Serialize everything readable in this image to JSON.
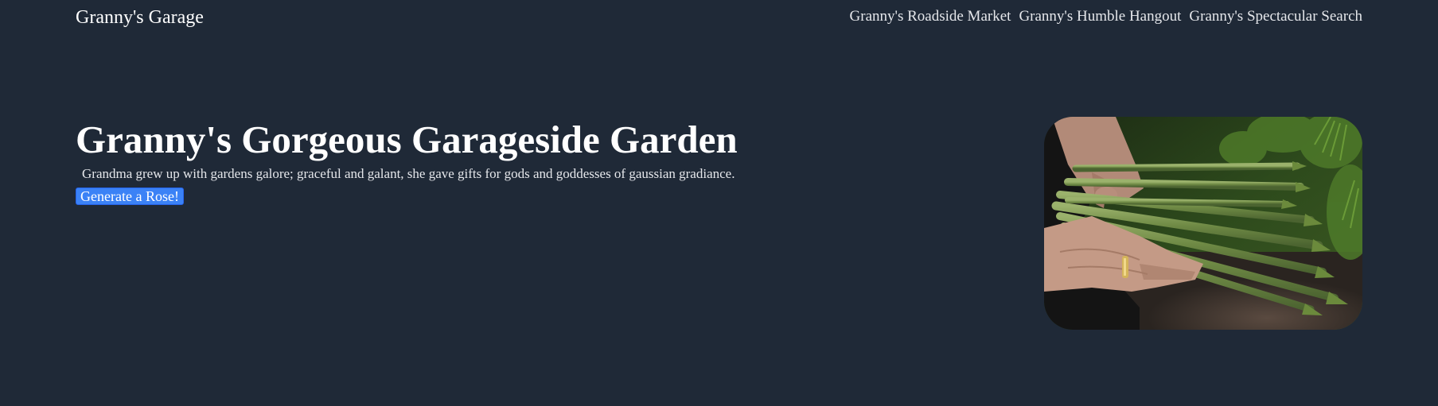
{
  "navbar": {
    "brand": "Granny's Garage",
    "links": [
      {
        "label": "Granny's Roadside Market"
      },
      {
        "label": "Granny's Humble Hangout"
      },
      {
        "label": "Granny's Spectacular Search"
      }
    ]
  },
  "hero": {
    "title": "Granny's Gorgeous Garageside Garden",
    "subtitle": "Grandma grew up with gardens galore; graceful and galant, she gave gifts for gods and goddesses of gaussian gradiance.",
    "button_label": "Generate a Rose!",
    "image": {
      "subject": "hands-holding-asparagus"
    }
  },
  "colors": {
    "background": "#1f2937",
    "button": "#3b82f6",
    "text": "#ffffff"
  }
}
